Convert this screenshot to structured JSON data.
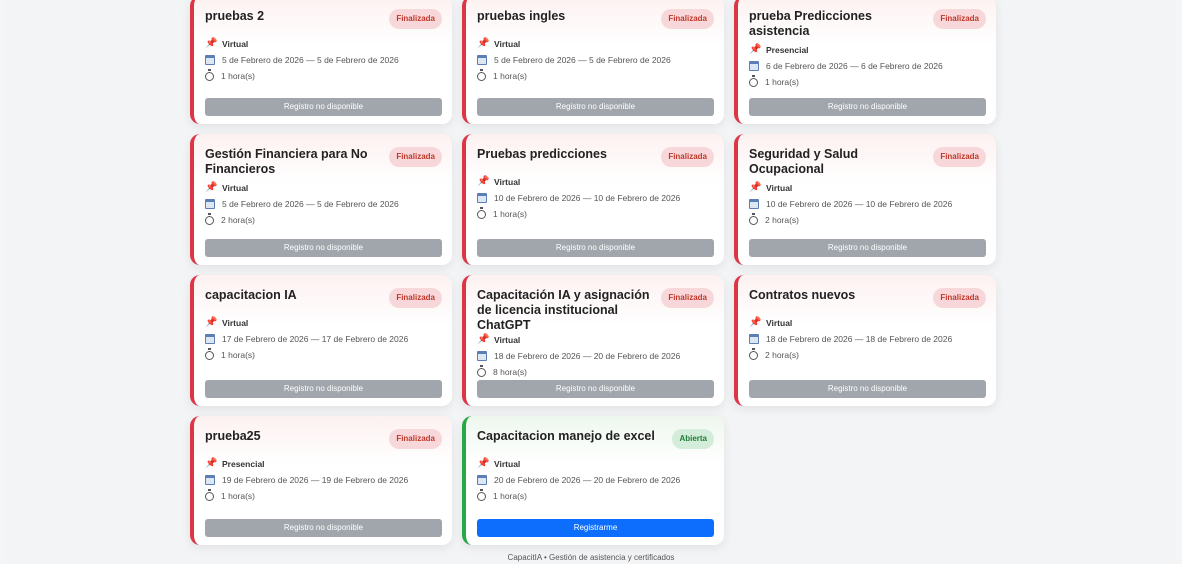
{
  "cards": [
    {
      "title": "pruebas 2",
      "status": "Finalizada",
      "mode": "Virtual",
      "dates": "5 de Febrero de 2026 — 5 de Febrero de 2026",
      "duration": "1 hora(s)",
      "button": "Registro no disponible"
    },
    {
      "title": "pruebas ingles",
      "status": "Finalizada",
      "mode": "Virtual",
      "dates": "5 de Febrero de 2026 — 5 de Febrero de 2026",
      "duration": "1 hora(s)",
      "button": "Registro no disponible"
    },
    {
      "title": "prueba Predicciones asistencia",
      "status": "Finalizada",
      "mode": "Presencial",
      "dates": "6 de Febrero de 2026 — 6 de Febrero de 2026",
      "duration": "1 hora(s)",
      "button": "Registro no disponible"
    },
    {
      "title": "Gestión Financiera para No Financieros",
      "status": "Finalizada",
      "mode": "Virtual",
      "dates": "5 de Febrero de 2026 — 5 de Febrero de 2026",
      "duration": "2 hora(s)",
      "button": "Registro no disponible"
    },
    {
      "title": "Pruebas predicciones",
      "status": "Finalizada",
      "mode": "Virtual",
      "dates": "10 de Febrero de 2026 — 10 de Febrero de 2026",
      "duration": "1 hora(s)",
      "button": "Registro no disponible"
    },
    {
      "title": "Seguridad y Salud Ocupacional",
      "status": "Finalizada",
      "mode": "Virtual",
      "dates": "10 de Febrero de 2026 — 10 de Febrero de 2026",
      "duration": "2 hora(s)",
      "button": "Registro no disponible"
    },
    {
      "title": "capacitacion IA",
      "status": "Finalizada",
      "mode": "Virtual",
      "dates": "17 de Febrero de 2026 — 17 de Febrero de 2026",
      "duration": "1 hora(s)",
      "button": "Registro no disponible"
    },
    {
      "title": "Capacitación IA y asignación de licencia institucional ChatGPT",
      "status": "Finalizada",
      "mode": "Virtual",
      "dates": "18 de Febrero de 2026 — 20 de Febrero de 2026",
      "duration": "8 hora(s)",
      "button": "Registro no disponible"
    },
    {
      "title": "Contratos nuevos",
      "status": "Finalizada",
      "mode": "Virtual",
      "dates": "18 de Febrero de 2026 — 18 de Febrero de 2026",
      "duration": "2 hora(s)",
      "button": "Registro no disponible"
    },
    {
      "title": "prueba25",
      "status": "Finalizada",
      "mode": "Presencial",
      "dates": "19 de Febrero de 2026 — 19 de Febrero de 2026",
      "duration": "1 hora(s)",
      "button": "Registro no disponible"
    },
    {
      "title": "Capacitacion manejo de excel",
      "status": "Abierta",
      "mode": "Virtual",
      "dates": "20 de Febrero de 2026 — 20 de Febrero de 2026",
      "duration": "1 hora(s)",
      "button": "Registrarme"
    }
  ],
  "footer": "CapacitIA • Gestión de asistencia y certificados",
  "colors": {
    "closed": "#dc3545",
    "open": "#28a745",
    "primary": "#0d6efd",
    "disabled": "#a1a6ad"
  }
}
